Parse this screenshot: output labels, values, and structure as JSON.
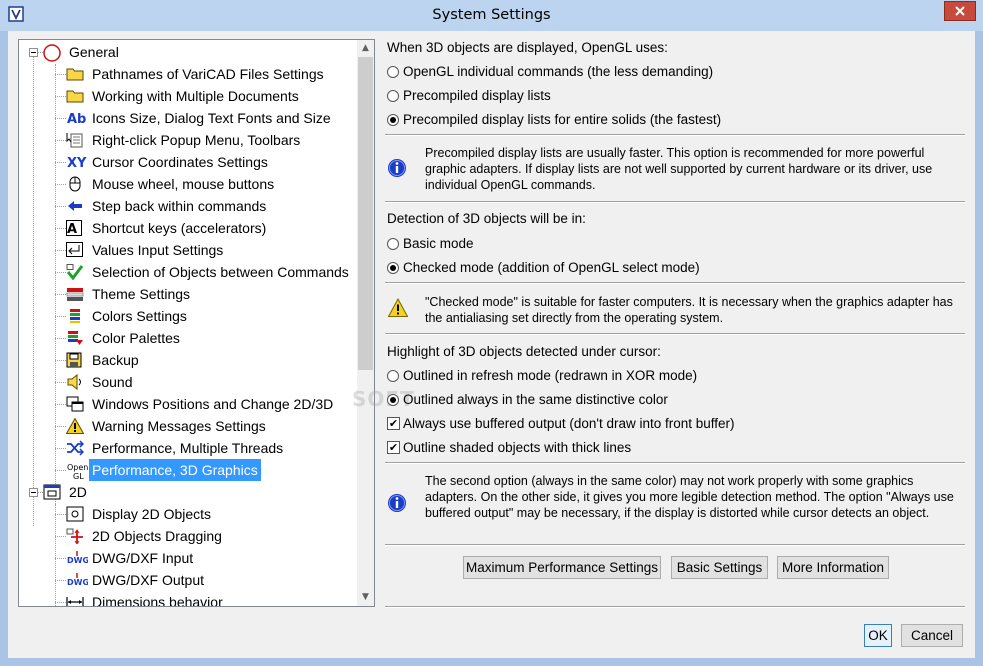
{
  "window": {
    "title": "System Settings"
  },
  "tree": {
    "items": [
      {
        "label": "General",
        "icon": "general-circle-icon"
      },
      {
        "label": "Pathnames of VariCAD Files Settings",
        "icon": "folder-icon"
      },
      {
        "label": "Working with Multiple Documents",
        "icon": "folder-icon"
      },
      {
        "label": "Icons Size, Dialog Text Fonts and Size",
        "icon": "ab-font-icon",
        "glyph": "Ab"
      },
      {
        "label": "Right-click Popup Menu, Toolbars",
        "icon": "popup-menu-icon"
      },
      {
        "label": "Cursor Coordinates Settings",
        "icon": "cursor-xy-icon",
        "glyph": "XY"
      },
      {
        "label": "Mouse wheel, mouse buttons",
        "icon": "mouse-icon"
      },
      {
        "label": "Step back within commands",
        "icon": "arrow-left-icon"
      },
      {
        "label": "Shortcut keys (accelerators)",
        "icon": "key-a-icon",
        "glyph": "A"
      },
      {
        "label": "Values Input Settings",
        "icon": "enter-key-icon"
      },
      {
        "label": "Selection of Objects between Commands",
        "icon": "selection-check-icon"
      },
      {
        "label": "Theme Settings",
        "icon": "theme-icon"
      },
      {
        "label": "Colors Settings",
        "icon": "colors-icon"
      },
      {
        "label": "Color Palettes",
        "icon": "palette-icon"
      },
      {
        "label": "Backup",
        "icon": "backup-icon"
      },
      {
        "label": "Sound",
        "icon": "speaker-icon"
      },
      {
        "label": "Windows Positions and Change 2D/3D",
        "icon": "windows-icon"
      },
      {
        "label": "Warning Messages Settings",
        "icon": "warning-icon"
      },
      {
        "label": "Performance, Multiple Threads",
        "icon": "shuffle-icon"
      },
      {
        "label": "Performance, 3D Graphics",
        "icon": "opengl-icon",
        "glyph_top": "Open",
        "glyph_bottom": "GL"
      },
      {
        "label": "2D",
        "icon": "2d-window-icon"
      },
      {
        "label": "Display 2D Objects",
        "icon": "display-2d-icon"
      },
      {
        "label": "2D Objects Dragging",
        "icon": "drag-icon"
      },
      {
        "label": "DWG/DXF Input",
        "icon": "dwg-input-icon",
        "glyph": "DWG"
      },
      {
        "label": "DWG/DXF Output",
        "icon": "dwg-output-icon",
        "glyph": "DWG"
      },
      {
        "label": "Dimensions behavior",
        "icon": "dimension-icon"
      }
    ],
    "selected_label": "Performance, 3D Graphics"
  },
  "opengl": {
    "heading": "When 3D objects are displayed, OpenGL uses:",
    "options": [
      {
        "label": "OpenGL individual commands (the less demanding)",
        "checked": false
      },
      {
        "label": "Precompiled display lists",
        "checked": false
      },
      {
        "label": "Precompiled display lists for entire solids (the fastest)",
        "checked": true
      }
    ],
    "note": "Precompiled display lists are usually faster. This option is recommended for more powerful graphic adapters. If display lists are not well supported by current hardware or its driver, use individual OpenGL commands."
  },
  "detection": {
    "heading": "Detection of 3D objects will be in:",
    "options": [
      {
        "label": "Basic mode",
        "checked": false
      },
      {
        "label": "Checked mode (addition of OpenGL select mode)",
        "checked": true
      }
    ],
    "note": "\"Checked mode\" is suitable for faster computers. It is necessary when the graphics adapter has the antialiasing set directly from the operating system."
  },
  "highlight": {
    "heading": "Highlight of 3D objects detected under cursor:",
    "options": [
      {
        "label": "Outlined in refresh mode (redrawn in XOR mode)",
        "checked": false
      },
      {
        "label": "Outlined always in the same distinctive color",
        "checked": true
      }
    ],
    "checkboxes": [
      {
        "label": "Always use buffered output (don't draw into front buffer)",
        "checked": true
      },
      {
        "label": "Outline shaded objects with thick lines",
        "checked": true
      }
    ],
    "note": "The second option (always in the same color) may not work properly with some graphics adapters. On the other side, it gives you more legible detection method. The option \"Always use buffered output\" may be necessary, if the display is distorted while cursor detects an object."
  },
  "buttons": {
    "max_perf": "Maximum Performance Settings",
    "basic": "Basic Settings",
    "more_info": "More Information",
    "ok": "OK",
    "cancel": "Cancel"
  },
  "watermark": "SOFT",
  "colors": {
    "selection": "#3399ff",
    "title_bar": "#bcd4ef",
    "close": "#c74a3a",
    "info_blue": "#1a3cc8",
    "warning_yellow": "#f5d21f"
  }
}
